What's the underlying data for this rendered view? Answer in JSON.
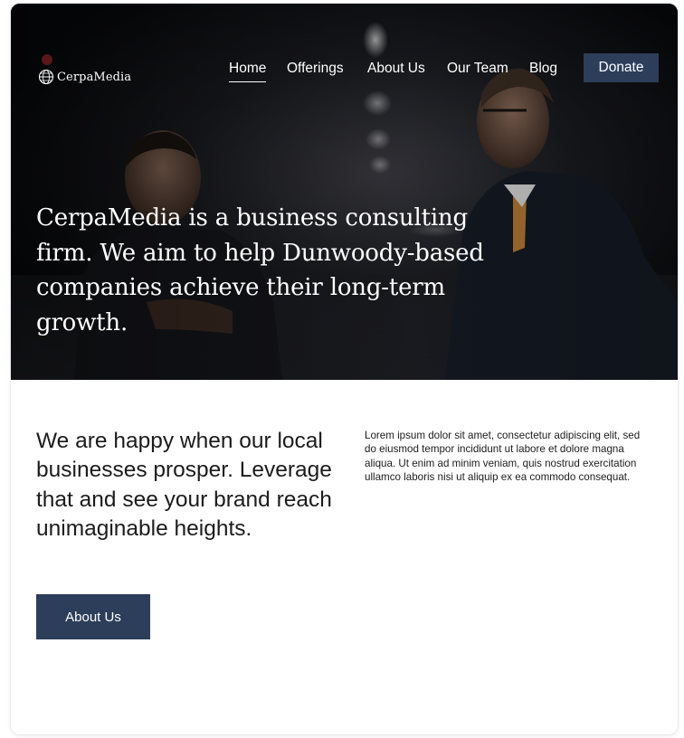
{
  "brand": {
    "name": "CerpaMedia",
    "logo_icon": "globe-icon"
  },
  "nav": {
    "items": [
      {
        "label": "Home",
        "active": true
      },
      {
        "label": "Offerings",
        "active": false
      },
      {
        "label": "About Us",
        "active": false
      },
      {
        "label": "Our Team",
        "active": false
      },
      {
        "label": "Blog",
        "active": false
      }
    ],
    "donate_label": "Donate"
  },
  "hero": {
    "headline": "CerpaMedia is a business consulting firm. We aim to help Dunwoody-based companies achieve their long-term growth.",
    "image_description_icon": "business-meeting-photo"
  },
  "main": {
    "heading": "We are happy when our local businesses prosper. Leverage that and see your brand reach unimaginable heights.",
    "body": "Lorem ipsum dolor sit amet, consectetur adipiscing elit, sed do eiusmod tempor incididunt ut labore et dolore magna aliqua. Ut enim ad minim veniam, quis nostrud exercitation ullamco laboris nisi ut aliquip ex ea commodo consequat.",
    "cta_label": "About Us"
  },
  "colors": {
    "accent": "#2c3e5a",
    "hero_bg": "#0b0c10",
    "text_dark": "#1c1c1c",
    "text_light": "#ffffff"
  }
}
